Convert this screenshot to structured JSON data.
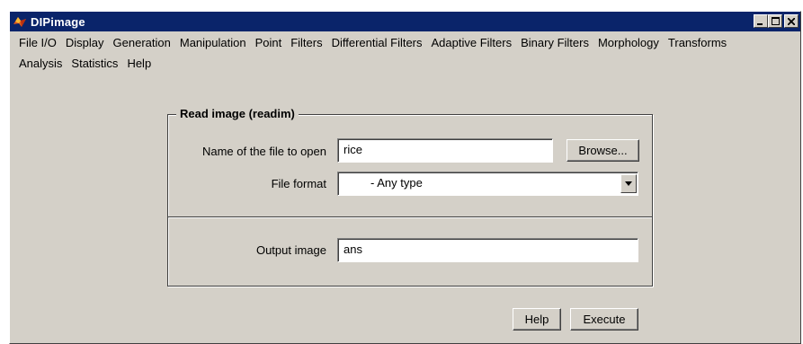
{
  "window": {
    "title": "DIPimage",
    "controls": {
      "minimize_icon": "minimize-icon",
      "maximize_icon": "maximize-icon",
      "close_icon": "close-icon"
    }
  },
  "menu": {
    "items": [
      "File I/O",
      "Display",
      "Generation",
      "Manipulation",
      "Point",
      "Filters",
      "Differential Filters",
      "Adaptive Filters",
      "Binary Filters",
      "Morphology",
      "Transforms",
      "Analysis",
      "Statistics",
      "Help"
    ]
  },
  "form": {
    "group_title": "Read image (readim)",
    "filename_label": "Name of the file to open",
    "filename_value": "rice",
    "browse_label": "Browse...",
    "format_label": "File format",
    "format_value": "- Any type",
    "output_label": "Output image",
    "output_value": "ans"
  },
  "actions": {
    "help_label": "Help",
    "execute_label": "Execute"
  },
  "colors": {
    "titlebar": "#0a246a",
    "face": "#d4d0c8",
    "field": "#ffffff"
  }
}
